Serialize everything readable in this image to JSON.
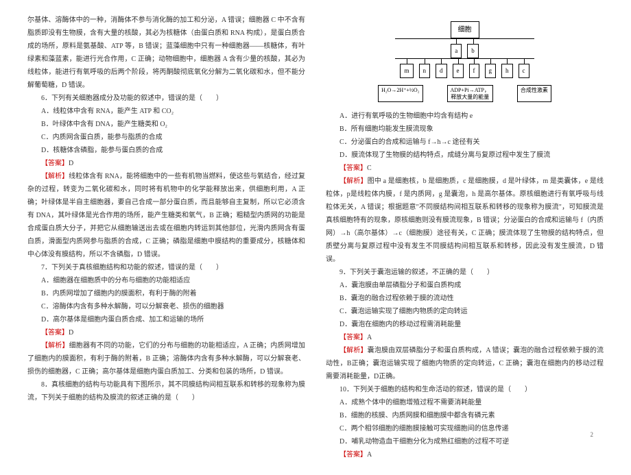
{
  "leftColumn": {
    "intro": "尔基体、溶酶体中的一种，消酶体不参与消化酶的加工和分泌，A 错误；细胞器 C 中不含有脂质即没有生物膜，含有大量的核酸，其必为核糖体（由蛋白质和 RNA 构成），是蛋白质合成的场所，原料是氨基酸、ATP 等，B 错误；蓝藻细胞中只有一种细胞器——核糖体，有叶绿素和藻蓝素，能进行光合作用，C 正确；动物细胞中，细胞器 A 含有少量的核酸，其必为线粒体，能进行有氧呼吸的后两个阶段，将丙酮酸彻底氧化分解为二氧化碳和水，但不能分解葡萄糖，D 错误。",
    "q6": {
      "stem": "6．下列有关细胞器成分及功能的叙述中，错误的是（　　）",
      "choices": {
        "A": "A．线粒体中含有 RNA，能产生 ATP 和 CO₂",
        "B": "B．叶绿体中含有 DNA，能产生糖类和 O₂",
        "C": "C．内质网含蛋白质，能参与脂质的合成",
        "D": "D．核糖体含磷脂，能参与蛋白质的合成"
      },
      "answerLabel": "【答案】",
      "answer": "D",
      "analysisLabel": "【解析】",
      "analysis": "线粒体含有 RNA，能将细胞中的一些有机物当燃料，使这些与氧结合，经过复杂的过程，转变为二氧化碳和水，同时将有机物中的化学能释放出来，供细胞利用，A 正确；叶绿体是半自主细胞器，要自己合成一部分蛋白质，而且能够自主复制，所以它必须含有 DNA，其叶绿体是光合作用的场所，能产生糖类和氧气，B 正确；粗糙型内质网的功能是合成蛋白质大分子，并把它从细胞输送出去或在细胞内转运到其他部位，光滑内质网含有蛋白质，滑面型内质网参与脂质的合成，C 正确；磷脂是细胞中膜结构的重要成分，核糖体和中心体没有膜结构，所以不含磷脂，D 错误。"
    },
    "q7": {
      "stem": "7．下列关于真核细胞结构和功能的叙述，错误的是（　　）",
      "choices": {
        "A": "A．细胞器在细胞质中的分布与细胞的功能相适应",
        "B": "B．内质网增加了细胞内的膜面积，有利于酶的附着",
        "C": "C．溶酶体内含有多种水解酶，可以分解衰老、损伤的细胞器",
        "D": "D．高尔基体是细胞内蛋白质合成、加工和运输的场所"
      },
      "answerLabel": "【答案】",
      "answer": "D",
      "analysisLabel": "【解析】",
      "analysis": "细胞器有不同的功能，它们的分布与细胞的功能相适应，A 正确；内质网增加了细胞内的膜面积，有利于酶的附着，B 正确；溶酶体内含有多种水解酶，可以分解衰老、损伤的细胞器，C 正确；高尔基体是细胞内蛋白质加工、分类和包装的场所，D 错误。"
    },
    "q8": {
      "stem": "8．真核细胞的结构与功能具有下图所示，其不同膜结构间相互联系和转移的现象称为膜流，下列关于细胞的结构及膜流的叙述正确的是（　　）"
    }
  },
  "rightColumn": {
    "diagram": {
      "top": "细胞",
      "row1": [
        "a",
        "b"
      ],
      "row2": [
        "m",
        "n",
        "d",
        "e",
        "f",
        "g",
        "h",
        "c"
      ],
      "labelLeft": "H₂O→2H⁺+½O₂",
      "labelMid": "ADP+Pi→ATP，\n释放大量的能量",
      "labelRight": "合成性激素"
    },
    "q8choices": {
      "A": "A．进行有氧呼吸的生物细胞中均含有结构 e",
      "B": "B．所有细胞均能发生膜流现象",
      "C": "C．分泌蛋白的合成和运输与 f→h→c 途径有关",
      "D": "D．膜流体现了生物膜的结构特点，成缝分离与复原过程中发生了膜流"
    },
    "q8answerLabel": "【答案】",
    "q8answer": "C",
    "q8analysisLabel": "【解析】",
    "q8analysis": "图中 a 是细胞核，b 是细胞质，c 是细胞膜，d 是叶绿体，m 是类囊体，e 是线粒体，p是线粒体内膜，f 是内质网，g 是囊泡，h 是高尔基体。原核细胞进行有氧呼吸与线粒体无关，A 错误；根据题意\"不同膜结构间相互联系和转移的现象称为膜流\"，可知膜流是真核细胞特有的现象，原核细胞则没有膜流现象，B 错误；分泌蛋白的合成和运输与 f（内质网）→h（高尔基体）→c（细胞膜）途径有关，C 正确；膜流体现了生物膜的结构特点，但质壁分离与复原过程中没有发生不同膜结构间相互联系和转移，因此没有发生膜流，D 错误。",
    "q9": {
      "stem": "9．下列关于囊泡运输的叙述，不正确的是（　　）",
      "choices": {
        "A": "A．囊泡膜由单层磷脂分子和蛋白质构成",
        "B": "B．囊泡的融合过程依赖于膜的流动性",
        "C": "C．囊泡运输实现了细胞内物质的定向转运",
        "D": "D．囊泡在细胞内的移动过程需消耗能量"
      },
      "answerLabel": "【答案】",
      "answer": "A",
      "analysisLabel": "【解析】",
      "analysis": "囊泡膜由双层磷脂分子和蛋白质构成，A 错误；囊泡的融合过程依赖于膜的流动性，B正确；囊泡运输实现了细胞内物质的定向转运，C 正确；囊泡在细胞内的移动过程需要消耗能量，D正确。"
    },
    "q10": {
      "stem": "10．下列关于细胞的结构和生命活动的叙述，错误的是（　　）",
      "choices": {
        "A": "A．成熟个体中的细胞增殖过程不需要消耗能量",
        "B": "B．细胞的核膜、内质网膜和细胞膜中都含有磷元素",
        "C": "C．两个相邻细胞的细胞膜接触可实现细胞间的信息传递",
        "D": "D．哺乳动物造血干细胞分化为成熟红细胞的过程不可逆"
      },
      "answerLabel": "【答案】",
      "answer": "A"
    }
  },
  "pageNum": "2"
}
